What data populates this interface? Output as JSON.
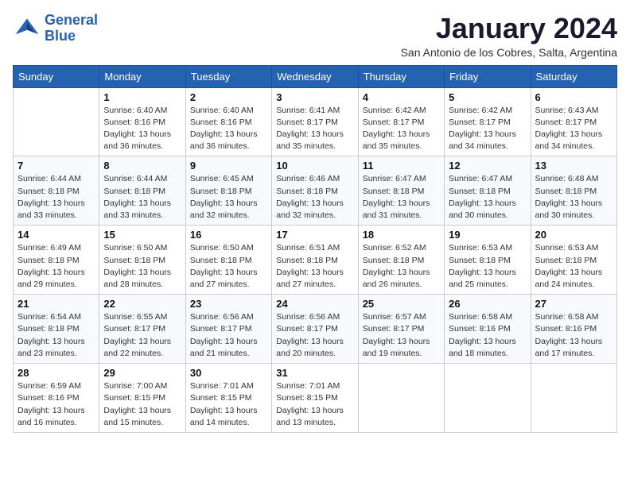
{
  "logo": {
    "line1": "General",
    "line2": "Blue"
  },
  "title": "January 2024",
  "subtitle": "San Antonio de los Cobres, Salta, Argentina",
  "weekdays": [
    "Sunday",
    "Monday",
    "Tuesday",
    "Wednesday",
    "Thursday",
    "Friday",
    "Saturday"
  ],
  "weeks": [
    [
      {
        "num": "",
        "detail": ""
      },
      {
        "num": "1",
        "detail": "Sunrise: 6:40 AM\nSunset: 8:16 PM\nDaylight: 13 hours\nand 36 minutes."
      },
      {
        "num": "2",
        "detail": "Sunrise: 6:40 AM\nSunset: 8:16 PM\nDaylight: 13 hours\nand 36 minutes."
      },
      {
        "num": "3",
        "detail": "Sunrise: 6:41 AM\nSunset: 8:17 PM\nDaylight: 13 hours\nand 35 minutes."
      },
      {
        "num": "4",
        "detail": "Sunrise: 6:42 AM\nSunset: 8:17 PM\nDaylight: 13 hours\nand 35 minutes."
      },
      {
        "num": "5",
        "detail": "Sunrise: 6:42 AM\nSunset: 8:17 PM\nDaylight: 13 hours\nand 34 minutes."
      },
      {
        "num": "6",
        "detail": "Sunrise: 6:43 AM\nSunset: 8:17 PM\nDaylight: 13 hours\nand 34 minutes."
      }
    ],
    [
      {
        "num": "7",
        "detail": "Sunrise: 6:44 AM\nSunset: 8:18 PM\nDaylight: 13 hours\nand 33 minutes."
      },
      {
        "num": "8",
        "detail": "Sunrise: 6:44 AM\nSunset: 8:18 PM\nDaylight: 13 hours\nand 33 minutes."
      },
      {
        "num": "9",
        "detail": "Sunrise: 6:45 AM\nSunset: 8:18 PM\nDaylight: 13 hours\nand 32 minutes."
      },
      {
        "num": "10",
        "detail": "Sunrise: 6:46 AM\nSunset: 8:18 PM\nDaylight: 13 hours\nand 32 minutes."
      },
      {
        "num": "11",
        "detail": "Sunrise: 6:47 AM\nSunset: 8:18 PM\nDaylight: 13 hours\nand 31 minutes."
      },
      {
        "num": "12",
        "detail": "Sunrise: 6:47 AM\nSunset: 8:18 PM\nDaylight: 13 hours\nand 30 minutes."
      },
      {
        "num": "13",
        "detail": "Sunrise: 6:48 AM\nSunset: 8:18 PM\nDaylight: 13 hours\nand 30 minutes."
      }
    ],
    [
      {
        "num": "14",
        "detail": "Sunrise: 6:49 AM\nSunset: 8:18 PM\nDaylight: 13 hours\nand 29 minutes."
      },
      {
        "num": "15",
        "detail": "Sunrise: 6:50 AM\nSunset: 8:18 PM\nDaylight: 13 hours\nand 28 minutes."
      },
      {
        "num": "16",
        "detail": "Sunrise: 6:50 AM\nSunset: 8:18 PM\nDaylight: 13 hours\nand 27 minutes."
      },
      {
        "num": "17",
        "detail": "Sunrise: 6:51 AM\nSunset: 8:18 PM\nDaylight: 13 hours\nand 27 minutes."
      },
      {
        "num": "18",
        "detail": "Sunrise: 6:52 AM\nSunset: 8:18 PM\nDaylight: 13 hours\nand 26 minutes."
      },
      {
        "num": "19",
        "detail": "Sunrise: 6:53 AM\nSunset: 8:18 PM\nDaylight: 13 hours\nand 25 minutes."
      },
      {
        "num": "20",
        "detail": "Sunrise: 6:53 AM\nSunset: 8:18 PM\nDaylight: 13 hours\nand 24 minutes."
      }
    ],
    [
      {
        "num": "21",
        "detail": "Sunrise: 6:54 AM\nSunset: 8:18 PM\nDaylight: 13 hours\nand 23 minutes."
      },
      {
        "num": "22",
        "detail": "Sunrise: 6:55 AM\nSunset: 8:17 PM\nDaylight: 13 hours\nand 22 minutes."
      },
      {
        "num": "23",
        "detail": "Sunrise: 6:56 AM\nSunset: 8:17 PM\nDaylight: 13 hours\nand 21 minutes."
      },
      {
        "num": "24",
        "detail": "Sunrise: 6:56 AM\nSunset: 8:17 PM\nDaylight: 13 hours\nand 20 minutes."
      },
      {
        "num": "25",
        "detail": "Sunrise: 6:57 AM\nSunset: 8:17 PM\nDaylight: 13 hours\nand 19 minutes."
      },
      {
        "num": "26",
        "detail": "Sunrise: 6:58 AM\nSunset: 8:16 PM\nDaylight: 13 hours\nand 18 minutes."
      },
      {
        "num": "27",
        "detail": "Sunrise: 6:58 AM\nSunset: 8:16 PM\nDaylight: 13 hours\nand 17 minutes."
      }
    ],
    [
      {
        "num": "28",
        "detail": "Sunrise: 6:59 AM\nSunset: 8:16 PM\nDaylight: 13 hours\nand 16 minutes."
      },
      {
        "num": "29",
        "detail": "Sunrise: 7:00 AM\nSunset: 8:15 PM\nDaylight: 13 hours\nand 15 minutes."
      },
      {
        "num": "30",
        "detail": "Sunrise: 7:01 AM\nSunset: 8:15 PM\nDaylight: 13 hours\nand 14 minutes."
      },
      {
        "num": "31",
        "detail": "Sunrise: 7:01 AM\nSunset: 8:15 PM\nDaylight: 13 hours\nand 13 minutes."
      },
      {
        "num": "",
        "detail": ""
      },
      {
        "num": "",
        "detail": ""
      },
      {
        "num": "",
        "detail": ""
      }
    ]
  ]
}
